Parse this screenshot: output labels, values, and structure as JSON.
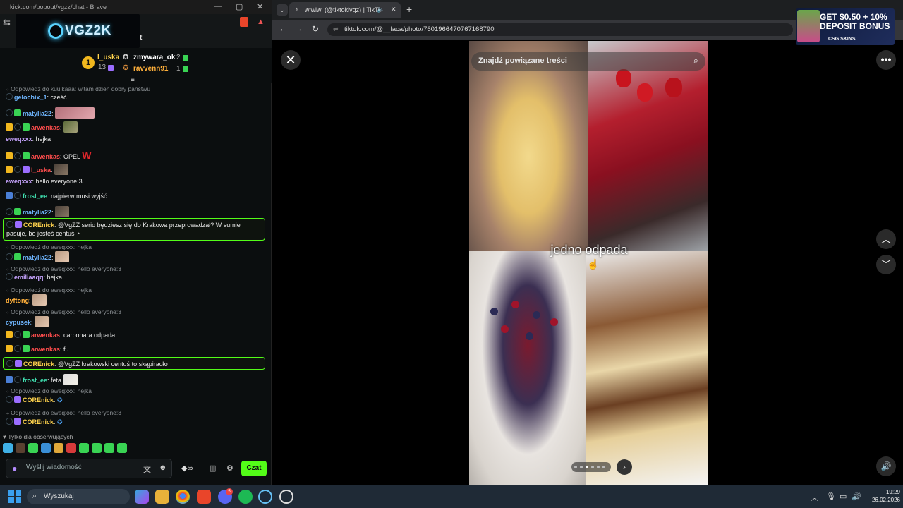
{
  "chat_window": {
    "title": "kick.com/popout/vgzz/chat - Brave",
    "logo": "VGZ2K",
    "leaderboard": {
      "first": {
        "rank": "1",
        "name": "l_uska",
        "count": "13"
      },
      "second": {
        "name": "zmywara_ok",
        "count": "2"
      },
      "third": {
        "name": "ravvenn91",
        "count": "1"
      }
    },
    "messages": [
      {
        "type": "reply",
        "text": "Odpowiedź do kuulkaaa: witam dzień dobry państwu"
      },
      {
        "type": "msg",
        "user": "gelochix_1",
        "color": "c-blue",
        "text": ": cześć"
      },
      {
        "type": "msg",
        "user": "matylia22",
        "color": "c-blue",
        "text": ":"
      },
      {
        "type": "msg",
        "user": "arwenkas",
        "color": "c-red",
        "text": ":"
      },
      {
        "type": "msg",
        "user": "eweqxxx",
        "color": "c-purple",
        "text": ": hejka"
      },
      {
        "type": "msg",
        "user": "arwenkas",
        "color": "c-red",
        "text": ": OPEL"
      },
      {
        "type": "msg",
        "user": "l_uska",
        "color": "c-red",
        "text": ":"
      },
      {
        "type": "msg",
        "user": "eweqxxx",
        "color": "c-purple",
        "text": ": hello everyone:3"
      },
      {
        "type": "msg",
        "user": "frost_ee",
        "color": "c-teal",
        "text": ": najpierw musi wyjść"
      },
      {
        "type": "msg",
        "user": "matylia22",
        "color": "c-blue",
        "text": ":"
      },
      {
        "type": "hl",
        "user": "COREnick",
        "color": "c-yellow",
        "line1": ": @VgZZ serio będziesz się do Krakowa przeprowadzał? W sumie",
        "line2": "pasuje, bo jesteś centuś"
      },
      {
        "type": "reply",
        "text": "Odpowiedź do eweqxxx: hejka"
      },
      {
        "type": "msg",
        "user": "matylia22",
        "color": "c-blue",
        "text": ":"
      },
      {
        "type": "reply",
        "text": "Odpowiedź do eweqxxx: hello everyone:3"
      },
      {
        "type": "msg",
        "user": "emiliaaqq",
        "color": "c-purple",
        "text": ": hejka"
      },
      {
        "type": "reply",
        "text": "Odpowiedź do eweqxxx: hejka"
      },
      {
        "type": "msg",
        "user": "dyftong",
        "color": "c-orange",
        "text": ":"
      },
      {
        "type": "reply",
        "text": "Odpowiedź do eweqxxx: hello everyone:3"
      },
      {
        "type": "msg",
        "user": "cypusek",
        "color": "c-blue",
        "text": ":"
      },
      {
        "type": "msg",
        "user": "arwenkas",
        "color": "c-red",
        "text": ": carbonara odpada"
      },
      {
        "type": "msg",
        "user": "arwenkas",
        "color": "c-red",
        "text": ": fu"
      },
      {
        "type": "hl",
        "user": "COREnick",
        "color": "c-yellow",
        "line1": ": @VgZZ krakowski centuś to skąpiradło",
        "line2": ""
      },
      {
        "type": "msg",
        "user": "frost_ee",
        "color": "c-teal",
        "text": ": feta"
      },
      {
        "type": "reply",
        "text": "Odpowiedź do eweqxxx: hejka"
      },
      {
        "type": "msg",
        "user": "COREnick",
        "color": "c-yellow",
        "text": ":"
      },
      {
        "type": "reply",
        "text": "Odpowiedź do eweqxxx: hello everyone:3"
      },
      {
        "type": "msg",
        "user": "COREnick",
        "color": "c-yellow",
        "text": ":"
      }
    ],
    "followers_only": "Tylko dla obserwujących",
    "input_placeholder": "Wyślij wiadomość",
    "send_label": "Czat"
  },
  "browser": {
    "tab_title": "wiwiwi (@tiktokivgz) | TikTo",
    "url": "tiktok.com/@__laca/photo/7601966470767168790",
    "ad": {
      "line1": "GET $0.50 + 10%",
      "line2": "DEPOSIT BONUS",
      "brand": "CSG SKINS"
    },
    "search_placeholder": "Znajdź powiązane treści",
    "caption": "jedno odpada"
  },
  "taskbar": {
    "search_label": "Wyszukaj",
    "time": "19:29",
    "date": "26.02.2026",
    "discord_badge": "5"
  },
  "icons": [
    "close-icon",
    "more-icon",
    "chevron-up-icon",
    "chevron-down-icon",
    "volume-icon",
    "search-icon",
    "mic-icon",
    "windows-start-icon"
  ]
}
